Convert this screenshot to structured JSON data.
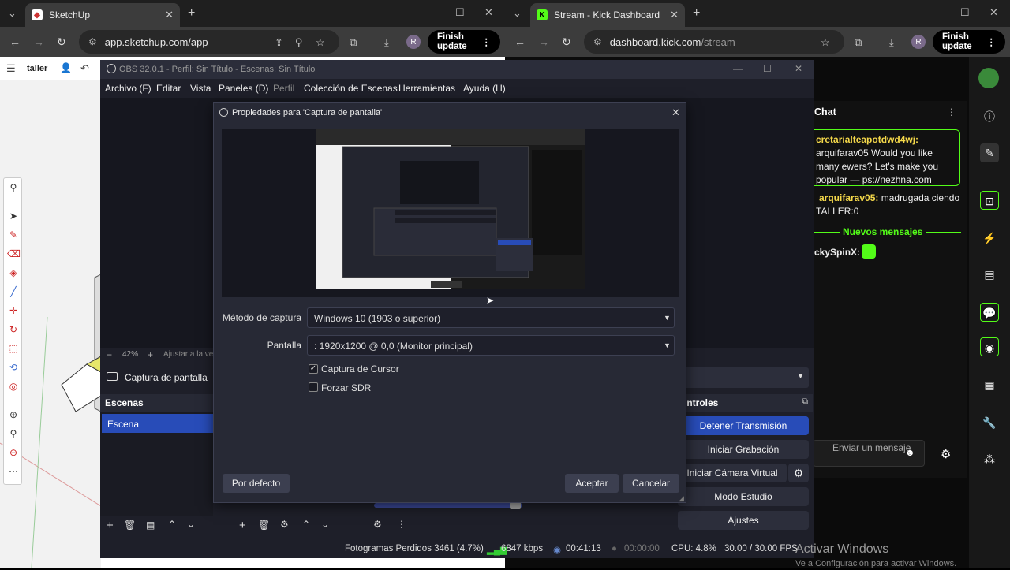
{
  "left_browser": {
    "tab_title": "SketchUp",
    "url": "app.sketchup.com/app",
    "finish": "Finish update",
    "avatar": "R"
  },
  "right_browser": {
    "tab_title": "Stream - Kick Dashboard",
    "url_host": "dashboard.kick.com",
    "url_path": "/stream",
    "finish": "Finish update",
    "avatar": "R"
  },
  "sketchup": {
    "file_label": "taller"
  },
  "kick": {
    "chat_title": "Chat",
    "messages": [
      {
        "user": "cretarialteapotdwd4wj:",
        "text": "arquifarav05 Would you like many ewers? Let's make you popular — ps://nezhna.com"
      },
      {
        "user": "arquifarav05:",
        "text": "madrugada ciendo TALLER:0"
      }
    ],
    "new_messages": "Nuevos mensajes",
    "last_user": "ckySpinX:",
    "send_placeholder": "Enviar un mensaje"
  },
  "obs": {
    "title": "OBS 32.0.1 - Perfil: Sin Título - Escenas: Sin Título",
    "menu": [
      "Archivo (F)",
      "Editar",
      "Vista",
      "Paneles (D)",
      "Perfil",
      "Colección de Escenas",
      "Herramientas",
      "Ayuda (H)"
    ],
    "zoom": "42%",
    "zoom_hint": "Ajustar a la ver",
    "source_name": "Captura de pantalla",
    "scenes_title": "Escenas",
    "scene_item": "Escena",
    "controls_title": "ontroles",
    "controls": [
      "Detener Transmisión",
      "Iniciar Grabación",
      "Iniciar Cámara Virtual",
      "Modo Estudio",
      "Ajustes"
    ],
    "status": {
      "dropped": "Fotogramas Perdidos 3461 (4.7%)",
      "kbps": "6847 kbps",
      "live": "00:41:13",
      "rec": "00:00:00",
      "cpu": "CPU: 4.8%",
      "fps": "30.00 / 30.00 FPS"
    }
  },
  "dialog": {
    "title": "Propiedades para 'Captura de pantalla'",
    "method_label": "Método de captura",
    "method_value": "Windows 10 (1903 o superior)",
    "screen_label": "Pantalla",
    "screen_value": ": 1920x1200 @ 0,0 (Monitor principal)",
    "cursor_label": "Captura de Cursor",
    "cursor_checked": true,
    "sdr_label": "Forzar SDR",
    "sdr_checked": false,
    "defaults": "Por defecto",
    "accept": "Aceptar",
    "cancel": "Cancelar"
  },
  "watermark": {
    "line1": "Activar Windows",
    "line2": "Ve a Configuración para activar Windows."
  }
}
